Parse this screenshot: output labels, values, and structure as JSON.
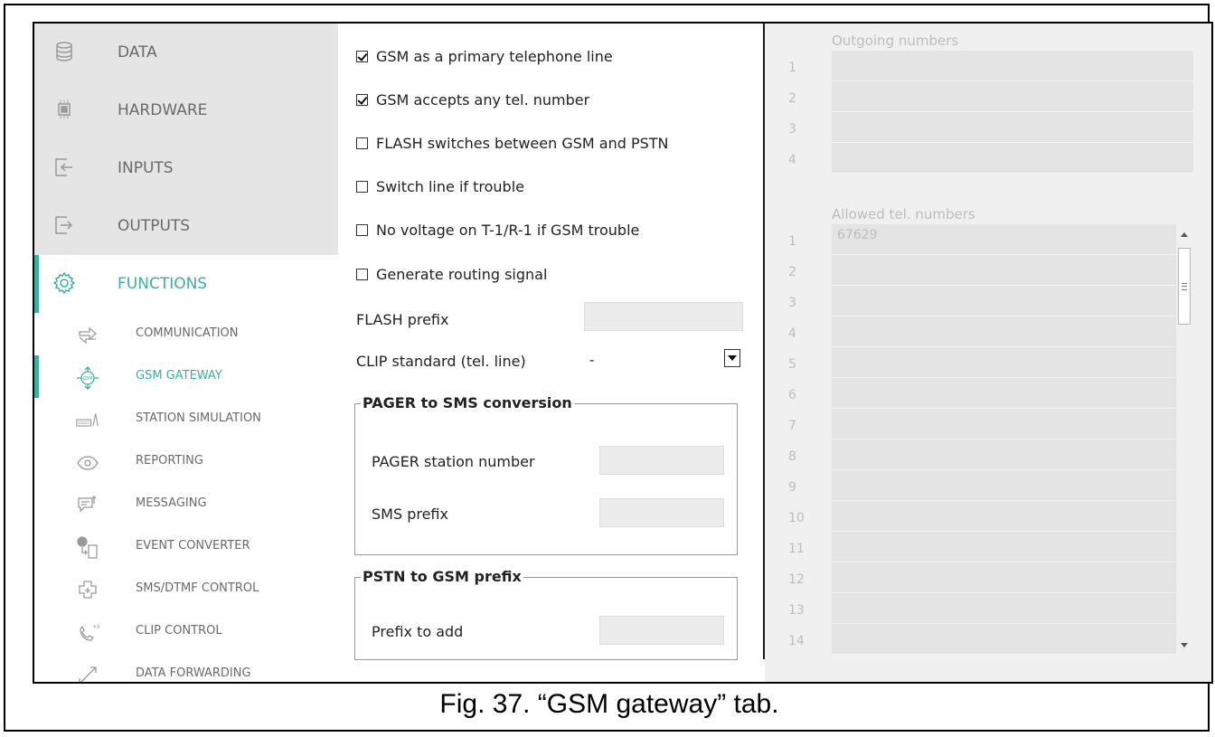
{
  "sidebar": {
    "main_items": [
      {
        "label": "DATA",
        "icon": "database-icon"
      },
      {
        "label": "HARDWARE",
        "icon": "chip-icon"
      },
      {
        "label": "INPUTS",
        "icon": "input-arrow-icon"
      },
      {
        "label": "OUTPUTS",
        "icon": "output-arrow-icon"
      },
      {
        "label": "FUNCTIONS",
        "icon": "gear-icon",
        "active": true
      }
    ],
    "sub_items": [
      {
        "label": "COMMUNICATION",
        "icon": "communication-arrows-icon"
      },
      {
        "label": "GSM GATEWAY",
        "icon": "gsm-gateway-icon",
        "active": true
      },
      {
        "label": "STATION SIMULATION",
        "icon": "station-icon"
      },
      {
        "label": "REPORTING",
        "icon": "eye-icon"
      },
      {
        "label": "MESSAGING",
        "icon": "message-icon"
      },
      {
        "label": "EVENT CONVERTER",
        "icon": "event-converter-icon"
      },
      {
        "label": "SMS/DTMF CONTROL",
        "icon": "sms-dtmf-icon"
      },
      {
        "label": "CLIP CONTROL",
        "icon": "phone-icon"
      },
      {
        "label": "DATA FORWARDING",
        "icon": "forward-arrows-icon"
      }
    ]
  },
  "settings": {
    "checkboxes": [
      {
        "label": "GSM as a primary telephone line",
        "checked": true
      },
      {
        "label": "GSM accepts any tel. number",
        "checked": true
      },
      {
        "label": "FLASH switches between GSM and PSTN",
        "checked": false
      },
      {
        "label": "Switch line if trouble",
        "checked": false
      },
      {
        "label": "No voltage on T-1/R-1 if GSM trouble",
        "checked": false
      },
      {
        "label": "Generate routing signal",
        "checked": false
      }
    ],
    "flash_prefix_label": "FLASH prefix",
    "flash_prefix_value": "",
    "clip_label": "CLIP standard (tel. line)",
    "clip_value": "-",
    "pager_group": {
      "title": "PAGER to SMS conversion",
      "station_label": "PAGER station number",
      "station_value": "",
      "sms_prefix_label": "SMS prefix",
      "sms_prefix_value": ""
    },
    "pstn_group": {
      "title": "PSTN to GSM prefix",
      "prefix_label": "Prefix to add",
      "prefix_value": ""
    }
  },
  "outgoing": {
    "title": "Outgoing numbers",
    "rows": [
      {
        "num": "1",
        "value": ""
      },
      {
        "num": "2",
        "value": ""
      },
      {
        "num": "3",
        "value": ""
      },
      {
        "num": "4",
        "value": ""
      }
    ]
  },
  "allowed": {
    "title": "Allowed tel. numbers",
    "rows": [
      {
        "num": "1",
        "value": "67629"
      },
      {
        "num": "2",
        "value": ""
      },
      {
        "num": "3",
        "value": ""
      },
      {
        "num": "4",
        "value": ""
      },
      {
        "num": "5",
        "value": ""
      },
      {
        "num": "6",
        "value": ""
      },
      {
        "num": "7",
        "value": ""
      },
      {
        "num": "8",
        "value": ""
      },
      {
        "num": "9",
        "value": ""
      },
      {
        "num": "10",
        "value": ""
      },
      {
        "num": "11",
        "value": ""
      },
      {
        "num": "12",
        "value": ""
      },
      {
        "num": "13",
        "value": ""
      },
      {
        "num": "14",
        "value": ""
      }
    ]
  },
  "caption": "Fig. 37. “GSM gateway” tab.",
  "colors": {
    "accent": "#3bafa0",
    "sidebar_bg": "#e5e5e5",
    "panel_bg": "#f0f0f0"
  }
}
